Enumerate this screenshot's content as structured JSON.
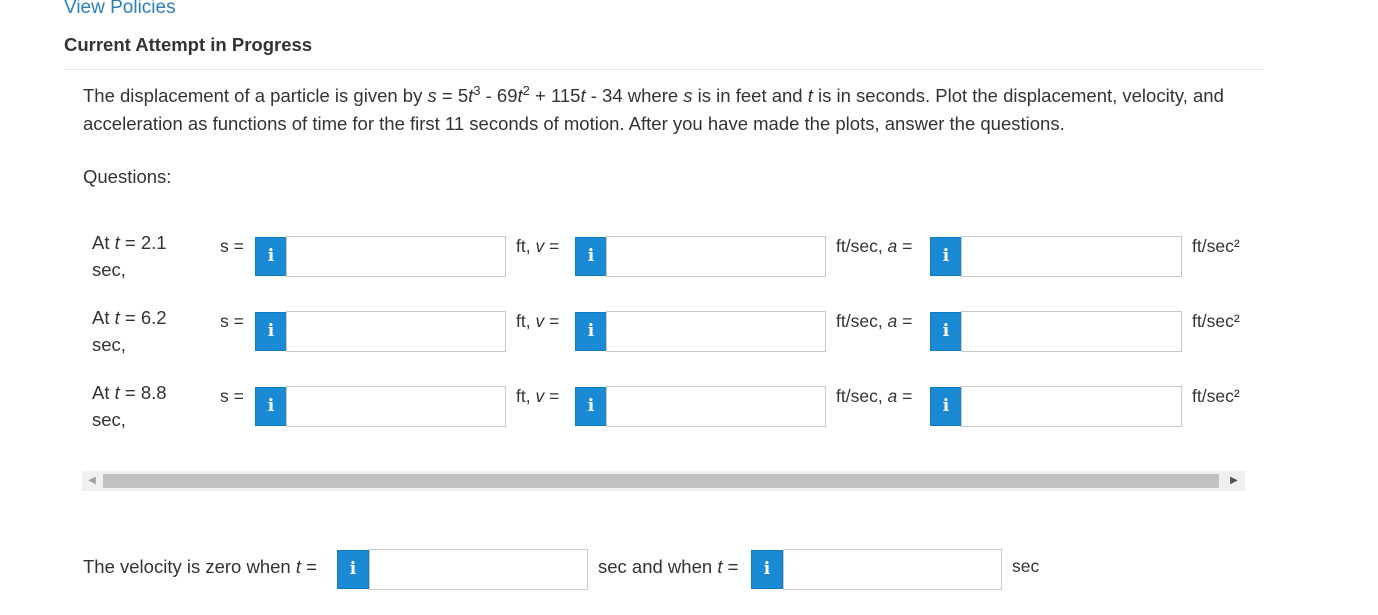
{
  "header": {
    "view_policies": "View Policies",
    "attempt_title": "Current Attempt in Progress"
  },
  "problem": {
    "part1": "The displacement of a particle is given by ",
    "s_var": "s",
    "eq1": " = 5",
    "t1": "t",
    "exp3": "3",
    "eq2": " - 69",
    "t2": "t",
    "exp2": "2",
    "eq3": " + 115",
    "t3": "t",
    "eq4": " - 34 where ",
    "s_var2": "s",
    "part2": " is in feet and ",
    "t4": "t",
    "part3": " is in seconds. Plot the displacement, velocity, and acceleration as functions of time for the first 11 seconds of motion. After you have made the plots, answer the questions."
  },
  "questions_label": "Questions:",
  "rows": [
    {
      "prefix": "At ",
      "t": "t",
      "value": " = 2.1",
      "unit": "sec,"
    },
    {
      "prefix": "At ",
      "t": "t",
      "value": " = 6.2",
      "unit": "sec,"
    },
    {
      "prefix": "At ",
      "t": "t",
      "value": " = 8.8",
      "unit": "sec,"
    }
  ],
  "labels": {
    "s_eq": "s =",
    "ft_v_prefix": "ft, ",
    "v_var": "v",
    "v_eq": " =",
    "ftsec_a_prefix": "ft/sec, ",
    "a_var": "a",
    "a_eq": " =",
    "unit_end": "ft/sec²",
    "info_icon": "i"
  },
  "inputs": {
    "value": ""
  },
  "velocity": {
    "prefix": "The velocity is zero when ",
    "t": "t",
    "eq": " =",
    "middle": "sec and when ",
    "t2": "t",
    "eq2": " =",
    "end": "sec"
  },
  "colors": {
    "link": "#2a7fc1",
    "info_button": "#1a8ad4",
    "text": "#333333"
  }
}
